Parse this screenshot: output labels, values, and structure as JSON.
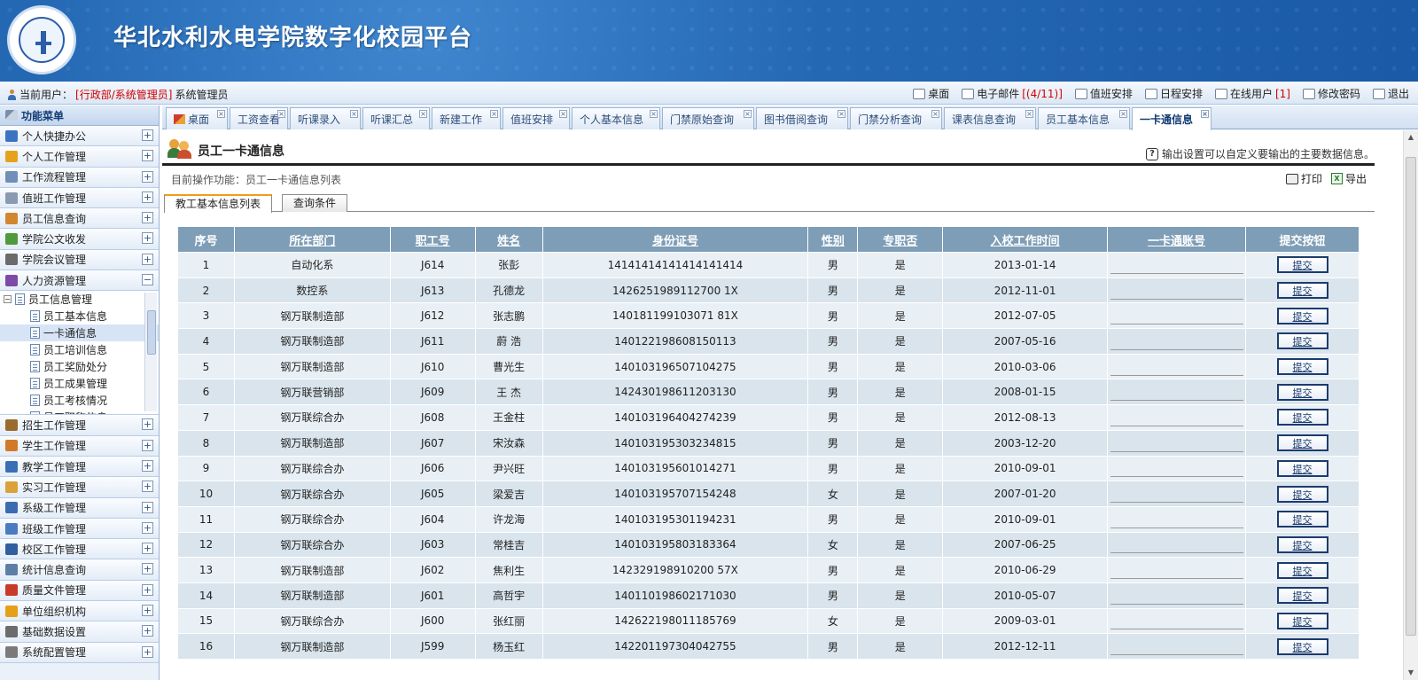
{
  "header": {
    "title": "华北水利水电学院数字化校园平台"
  },
  "userbar": {
    "label": "当前用户：",
    "dept": "[行政部/系统管理员]",
    "name": "系统管理员",
    "links": [
      {
        "label": "桌面",
        "icon": "home-icon"
      },
      {
        "label": "电子邮件",
        "extra": "[(4/11)]",
        "icon": "mail-icon"
      },
      {
        "label": "值班安排",
        "icon": "duty-chart-icon"
      },
      {
        "label": "日程安排",
        "icon": "clock-icon"
      },
      {
        "label": "在线用户",
        "extra": "[1]",
        "icon": "online-users-icon"
      },
      {
        "label": "修改密码",
        "icon": "password-icon"
      },
      {
        "label": "退出",
        "icon": "exit-icon"
      }
    ]
  },
  "sidebar": {
    "title": "功能菜单",
    "items_top": [
      {
        "label": "个人快捷办公",
        "color": "#3b74c2"
      },
      {
        "label": "个人工作管理",
        "color": "#e6a21d"
      },
      {
        "label": "工作流程管理",
        "color": "#6f8fb8"
      },
      {
        "label": "值班工作管理",
        "color": "#8a9bb1"
      },
      {
        "label": "员工信息查询",
        "color": "#d1862f"
      },
      {
        "label": "学院公文收发",
        "color": "#4f9a3c"
      },
      {
        "label": "学院会议管理",
        "color": "#6b6b6b"
      },
      {
        "label": "人力资源管理",
        "color": "#7d4aa8",
        "expanded": true
      }
    ],
    "tree": {
      "root": "员工信息管理",
      "children": [
        "员工基本信息",
        "一卡通信息",
        "员工培训信息",
        "员工奖励处分",
        "员工成果管理",
        "员工考核情况",
        "员工职称信息"
      ]
    },
    "items_bottom": [
      {
        "label": "招生工作管理",
        "color": "#9a6a2f"
      },
      {
        "label": "学生工作管理",
        "color": "#d27a2a"
      },
      {
        "label": "教学工作管理",
        "color": "#3a6fb5"
      },
      {
        "label": "实习工作管理",
        "color": "#d9a23b"
      },
      {
        "label": "系级工作管理",
        "color": "#3b6cb0"
      },
      {
        "label": "班级工作管理",
        "color": "#4a7cc0"
      },
      {
        "label": "校区工作管理",
        "color": "#2f5f9e"
      },
      {
        "label": "统计信息查询",
        "color": "#5e7ea6"
      },
      {
        "label": "质量文件管理",
        "color": "#c83a2a"
      },
      {
        "label": "单位组织机构",
        "color": "#e3a018"
      },
      {
        "label": "基础数据设置",
        "color": "#6c6c6c"
      },
      {
        "label": "系统配置管理",
        "color": "#7a7a7a"
      }
    ]
  },
  "tabs": [
    {
      "label": "桌面"
    },
    {
      "label": "工资查看"
    },
    {
      "label": "听课录入"
    },
    {
      "label": "听课汇总"
    },
    {
      "label": "新建工作"
    },
    {
      "label": "值班安排"
    },
    {
      "label": "个人基本信息"
    },
    {
      "label": "门禁原始查询"
    },
    {
      "label": "图书借阅查询"
    },
    {
      "label": "门禁分析查询"
    },
    {
      "label": "课表信息查询"
    },
    {
      "label": "员工基本信息"
    },
    {
      "label": "一卡通信息",
      "active": true
    }
  ],
  "page": {
    "title": "员工一卡通信息",
    "tip": "输出设置可以自定义要输出的主要数据信息。",
    "breadcrumb": "目前操作功能：员工一卡通信息列表",
    "print": "打印",
    "export": "导出",
    "subtabs": [
      "教工基本信息列表",
      "查询条件"
    ]
  },
  "table": {
    "headers": [
      "序号",
      "所在部门",
      "职工号",
      "姓名",
      "身份证号",
      "性别",
      "专职否",
      "入校工作时间",
      "一卡通账号",
      "提交按钮"
    ],
    "button_label": "提交",
    "rows": [
      [
        "1",
        "自动化系",
        "J614",
        "张彭",
        "14141414141414141414",
        "男",
        "是",
        "2013-01-14"
      ],
      [
        "2",
        "数控系",
        "J613",
        "孔德龙",
        "1426251989112700 1X",
        "男",
        "是",
        "2012-11-01"
      ],
      [
        "3",
        "钢万联制造部",
        "J612",
        "张志鹏",
        "140181199103071 81X",
        "男",
        "是",
        "2012-07-05"
      ],
      [
        "4",
        "钢万联制造部",
        "J611",
        "蔚 浩",
        "140122198608150113",
        "男",
        "是",
        "2007-05-16"
      ],
      [
        "5",
        "钢万联制造部",
        "J610",
        "曹光生",
        "140103196507104275",
        "男",
        "是",
        "2010-03-06"
      ],
      [
        "6",
        "钢万联营销部",
        "J609",
        "王 杰",
        "142430198611203130",
        "男",
        "是",
        "2008-01-15"
      ],
      [
        "7",
        "钢万联综合办",
        "J608",
        "王金柱",
        "140103196404274239",
        "男",
        "是",
        "2012-08-13"
      ],
      [
        "8",
        "钢万联制造部",
        "J607",
        "宋汝森",
        "140103195303234815",
        "男",
        "是",
        "2003-12-20"
      ],
      [
        "9",
        "钢万联综合办",
        "J606",
        "尹兴旺",
        "140103195601014271",
        "男",
        "是",
        "2010-09-01"
      ],
      [
        "10",
        "钢万联综合办",
        "J605",
        "梁爱吉",
        "140103195707154248",
        "女",
        "是",
        "2007-01-20"
      ],
      [
        "11",
        "钢万联综合办",
        "J604",
        "许龙海",
        "140103195301194231",
        "男",
        "是",
        "2010-09-01"
      ],
      [
        "12",
        "钢万联综合办",
        "J603",
        "常桂吉",
        "140103195803183364",
        "女",
        "是",
        "2007-06-25"
      ],
      [
        "13",
        "钢万联制造部",
        "J602",
        "焦利生",
        "142329198910200 57X",
        "男",
        "是",
        "2010-06-29"
      ],
      [
        "14",
        "钢万联制造部",
        "J601",
        "高哲宇",
        "140110198602171030",
        "男",
        "是",
        "2010-05-07"
      ],
      [
        "15",
        "钢万联综合办",
        "J600",
        "张红丽",
        "142622198011185769",
        "女",
        "是",
        "2009-03-01"
      ],
      [
        "16",
        "钢万联制造部",
        "J599",
        "杨玉红",
        "142201197304042755",
        "男",
        "是",
        "2012-12-11"
      ]
    ]
  }
}
